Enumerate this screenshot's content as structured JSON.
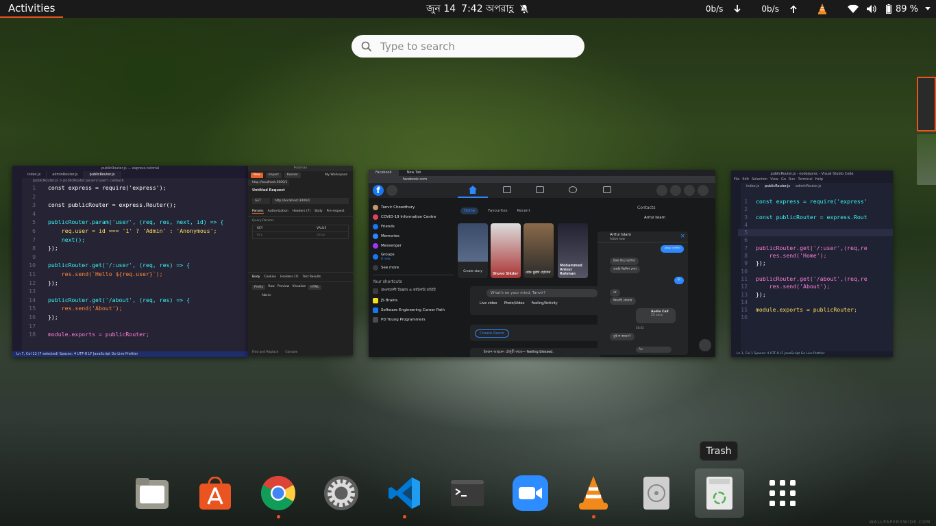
{
  "topbar": {
    "activities": "Activities",
    "date": "জুন 14",
    "time": "7:42 অপরাহ্ণ",
    "net_down": "0b/s",
    "net_up": "0b/s",
    "battery": "89 %"
  },
  "search": {
    "placeholder": "Type to search"
  },
  "windows": {
    "vscode_left": {
      "title": "publicRouter.js — express-tutorial",
      "tabs": [
        "index.js",
        "adminRouter.js",
        "publicRouter.js"
      ],
      "breadcrumb": "publicRouter.js > publicRouter.param('user') callback",
      "code": [
        {
          "n": "1",
          "text": "const express = require('express');"
        },
        {
          "n": "2",
          "text": ""
        },
        {
          "n": "3",
          "text": "const publicRouter = express.Router();"
        },
        {
          "n": "4",
          "text": ""
        },
        {
          "n": "5",
          "text": "publicRouter.param('user', (req, res, next, id) => {"
        },
        {
          "n": "6",
          "text": "    req.user = id === '1' ? 'Admin' : 'Anonymous';"
        },
        {
          "n": "7",
          "text": "    next();"
        },
        {
          "n": "8",
          "text": "});"
        },
        {
          "n": "9",
          "text": ""
        },
        {
          "n": "10",
          "text": "publicRouter.get('/:user', (req, res) => {"
        },
        {
          "n": "11",
          "text": "    res.send(`Hello ${req.user}`);"
        },
        {
          "n": "12",
          "text": "});"
        },
        {
          "n": "13",
          "text": ""
        },
        {
          "n": "14",
          "text": "publicRouter.get('/about', (req, res) => {"
        },
        {
          "n": "15",
          "text": "    res.send('About');"
        },
        {
          "n": "16",
          "text": "});"
        },
        {
          "n": "17",
          "text": ""
        },
        {
          "n": "18",
          "text": "module.exports = publicRouter;"
        }
      ],
      "status": "Ln 7, Col 12 (7 selected)   Spaces: 4   UTF-8   LF   JavaScript   Go Live   Prettier"
    },
    "postman": {
      "title": "Postman",
      "new_label": "New",
      "import_label": "Import",
      "runner_label": "Runner",
      "workspace": "My Workspace",
      "tab_url": "http://localhost:3000/1",
      "request_title": "Untitled Request",
      "method": "GET",
      "url": "http://localhost:3000/1",
      "req_tabs": [
        "Params",
        "Authorization",
        "Headers (7)",
        "Body",
        "Pre-request"
      ],
      "query_params": "Query Params",
      "key_col": "KEY",
      "value_col": "VALUE",
      "key_ph": "Key",
      "value_ph": "Value",
      "resp_tabs": [
        "Body",
        "Cookies",
        "Headers (7)",
        "Test Results"
      ],
      "view_tabs": [
        "Pretty",
        "Raw",
        "Preview",
        "Visualize",
        "HTML"
      ],
      "resp_body": "Admin",
      "footer": [
        "Find and Replace",
        "Console"
      ]
    },
    "chrome_facebook": {
      "tabs": [
        "Facebook",
        "New Tab"
      ],
      "url": "facebook.com",
      "left_items": [
        "Tanvir Chowdhury",
        "COVID-19 Information Centre",
        "Friends",
        "Memories",
        "Messenger",
        "Groups",
        "See more"
      ],
      "groups_sub": "8 new",
      "shortcuts_title": "Your shortcuts",
      "shortcuts": [
        "বাংলাদেশী বিজ্ঞান ও কারিগরি কমিটি",
        "JS Brains",
        "Software Engineering Career Path",
        "PD Young Programmers"
      ],
      "feed_tabs": [
        "Home",
        "Favourites",
        "Recent"
      ],
      "create_story": "Create story",
      "stories": [
        "Shuvo Sikder",
        "মোঃ মুরাদ হোসেন",
        "Mohammed Anisur Rahman"
      ],
      "post_placeholder": "What's on your mind, Tanvir?",
      "post_actions": [
        "Live video",
        "Photo/Video",
        "Feeling/Activity"
      ],
      "create_room": "Create Room",
      "post_snippet": "ইমরান আহমেদ চৌধুরী কারে— feeling blessed.",
      "contacts_title": "Contacts",
      "contact1": "Ariful Islam",
      "chat_name": "Ariful Islam",
      "chat_status": "Active now",
      "chat_messages": [
        "কেমন আছিস",
        "টাকা দিয়ে আসিস",
        "একটা জিনিস দেখা",
        "কী",
        "নে",
        "কিনেছি কোথায়",
        "Audio Call",
        "25 secs",
        "তুই ক কারণে?"
      ],
      "chat_time": "10:41",
      "chat_input": "Aa"
    },
    "vscode_right": {
      "title": "publicRouter.js - nodejsproc - Visual Studio Code",
      "menu": [
        "File",
        "Edit",
        "Selection",
        "View",
        "Go",
        "Run",
        "Terminal",
        "Help"
      ],
      "tabs": [
        "index.js",
        "publicRouter.js",
        "adminRouter.js"
      ],
      "code": [
        {
          "n": "1",
          "text": "const express = require('express'"
        },
        {
          "n": "2",
          "text": ""
        },
        {
          "n": "3",
          "text": "const publicRouter = express.Rout"
        },
        {
          "n": "4",
          "text": ""
        },
        {
          "n": "5",
          "text": ""
        },
        {
          "n": "6",
          "text": ""
        },
        {
          "n": "7",
          "text": "publicRouter.get('/:user',(req,re"
        },
        {
          "n": "8",
          "text": "    res.send('Home');"
        },
        {
          "n": "9",
          "text": "});"
        },
        {
          "n": "10",
          "text": ""
        },
        {
          "n": "11",
          "text": "publicRouter.get('/about',(req,re"
        },
        {
          "n": "12",
          "text": "    res.send('About');"
        },
        {
          "n": "13",
          "text": "});"
        },
        {
          "n": "14",
          "text": ""
        },
        {
          "n": "15",
          "text": "module.exports = publicRouter;"
        },
        {
          "n": "16",
          "text": ""
        }
      ],
      "status": "Ln 1, Col 1   Spaces: 4   UTF-8   LF   JavaScript   Go Live   Prettier"
    }
  },
  "tooltip": "Trash",
  "dock": [
    {
      "name": "Files",
      "icon": "files-icon",
      "running": false
    },
    {
      "name": "Ubuntu Software",
      "icon": "software-icon",
      "running": false
    },
    {
      "name": "Google Chrome",
      "icon": "chrome-icon",
      "running": true
    },
    {
      "name": "Settings",
      "icon": "settings-icon",
      "running": false
    },
    {
      "name": "Visual Studio Code",
      "icon": "vscode-icon",
      "running": true
    },
    {
      "name": "Terminal",
      "icon": "terminal-icon",
      "running": false
    },
    {
      "name": "Zoom",
      "icon": "zoom-icon",
      "running": false
    },
    {
      "name": "VLC",
      "icon": "vlc-icon",
      "running": true
    },
    {
      "name": "Disk",
      "icon": "disk-icon",
      "running": false
    },
    {
      "name": "Trash",
      "icon": "trash-icon",
      "running": false
    },
    {
      "name": "Show Applications",
      "icon": "app-grid-icon",
      "running": false
    }
  ],
  "watermark": "WALLPAPERSWIDE.COM",
  "colors": {
    "accent": "#e95420",
    "topbar": "#1a1a1a"
  }
}
